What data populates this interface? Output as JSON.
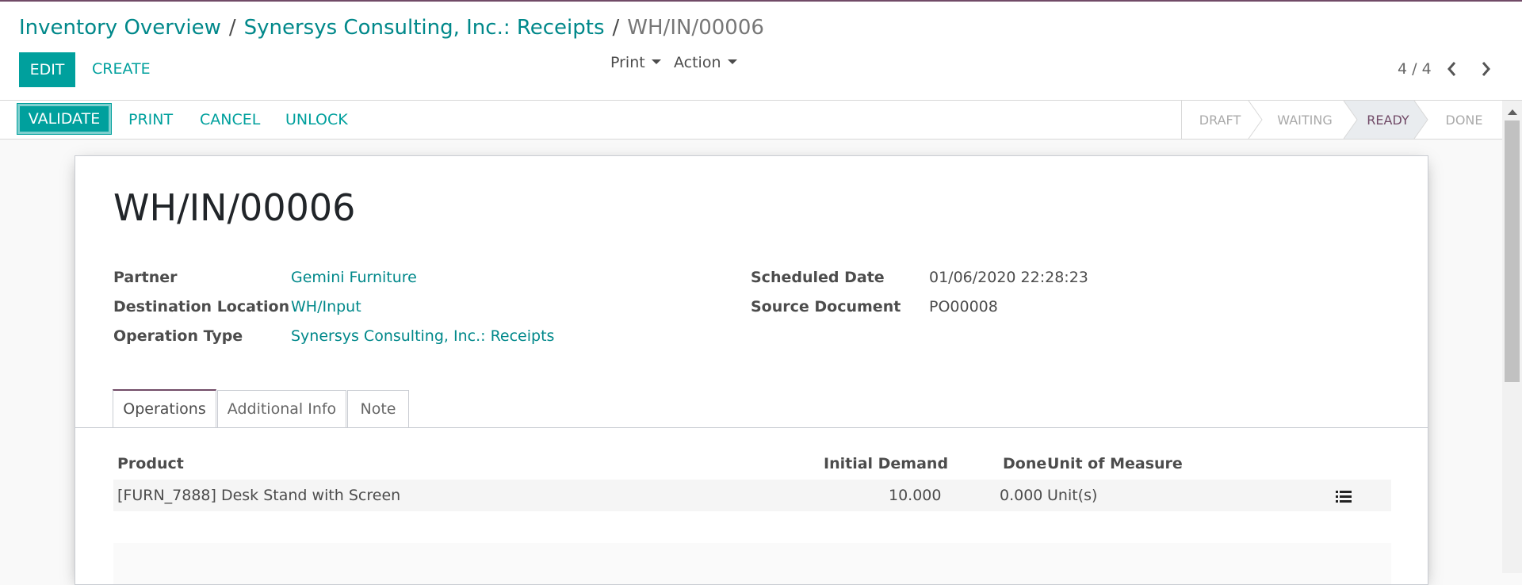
{
  "breadcrumb": {
    "items": [
      "Inventory Overview",
      "Synersys Consulting, Inc.: Receipts"
    ],
    "current": "WH/IN/00006",
    "separator": "/"
  },
  "control_panel": {
    "edit_label": "EDIT",
    "create_label": "CREATE",
    "print_label": "Print",
    "action_label": "Action",
    "pager": "4 / 4"
  },
  "statusbar": {
    "validate_label": "VALIDATE",
    "print_label": "PRINT",
    "cancel_label": "CANCEL",
    "unlock_label": "UNLOCK",
    "stages": [
      "DRAFT",
      "WAITING",
      "READY",
      "DONE"
    ],
    "active_stage": "READY"
  },
  "record": {
    "name": "WH/IN/00006",
    "fields_left": [
      {
        "label": "Partner",
        "value": "Gemini Furniture"
      },
      {
        "label": "Destination Location",
        "value": "WH/Input"
      },
      {
        "label": "Operation Type",
        "value": "Synersys Consulting, Inc.: Receipts"
      }
    ],
    "fields_right": [
      {
        "label": "Scheduled Date",
        "value": "01/06/2020 22:28:23"
      },
      {
        "label": "Source Document",
        "value": "PO00008"
      }
    ]
  },
  "tabs": [
    {
      "label": "Operations",
      "active": true
    },
    {
      "label": "Additional Info",
      "active": false
    },
    {
      "label": "Note",
      "active": false
    }
  ],
  "operations_table": {
    "columns": [
      "Product",
      "Initial Demand",
      "Done",
      "Unit of Measure"
    ],
    "rows": [
      {
        "product": "[FURN_7888] Desk Stand with Screen",
        "initial_demand": "10.000",
        "done": "0.000",
        "uom": "Unit(s)",
        "icon": "list-icon"
      }
    ]
  },
  "colors": {
    "primary": "#00a09d",
    "brand": "#714b67",
    "link": "#00888a"
  }
}
